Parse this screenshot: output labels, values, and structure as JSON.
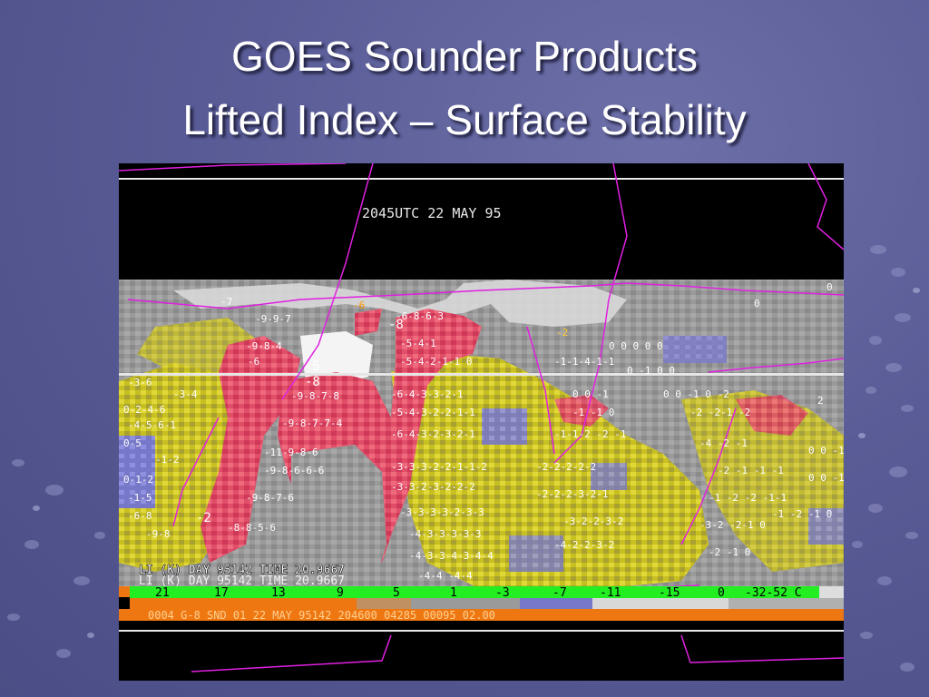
{
  "slide": {
    "title_line1": "GOES Sounder Products",
    "title_line2": "Lifted Index – Surface Stability"
  },
  "image": {
    "timestamp": "2045UTC 22 MAY 95",
    "overlay_label_1": "LI (K) DAY 95142  TIME 20.9667",
    "overlay_label_2": "LI (K) DAY 95142  TIME 20.9667",
    "colorbar_values": [
      "21",
      "17",
      "13",
      "9",
      "5",
      "1",
      "-3",
      "-7",
      "-11",
      "-15",
      "0",
      "-32-52 C"
    ],
    "footer_text": "0004 G-8 SND     01 22 MAY 95142 204600 04285 00095 02.00",
    "map_labels": [
      "-5",
      "-8",
      "-8",
      "-2",
      "-7",
      "-6",
      "-2"
    ]
  },
  "colors": {
    "background": "#5a5c97",
    "colorbar_green": "#22ee22",
    "footer_orange": "#ee7711",
    "unstable_red": "#e8506a",
    "marginal_yellow": "#d8d020",
    "stable_blue": "#7a7ad0",
    "boundary_magenta": "#e020e0"
  }
}
